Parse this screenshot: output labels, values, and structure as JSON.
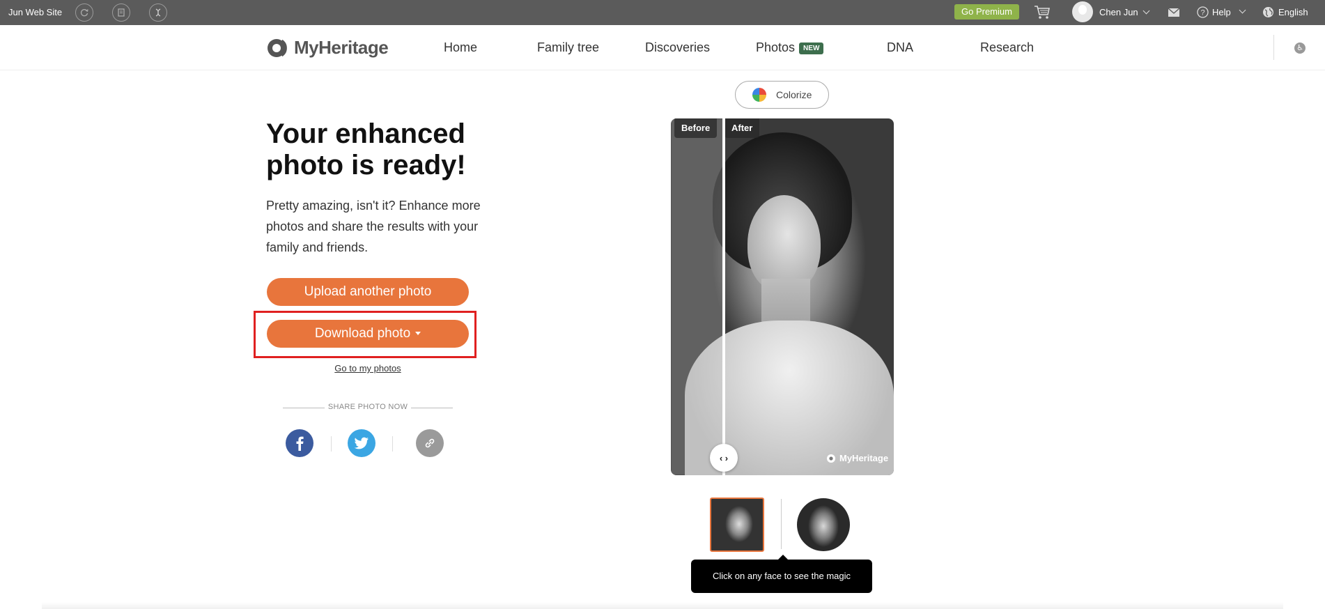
{
  "topbar": {
    "site_name": "Jun Web Site",
    "premium_label": "Go Premium",
    "user_name": "Chen Jun",
    "help_label": "Help",
    "language": "English",
    "premium_color": "#8fb34a"
  },
  "nav": {
    "logo_text": "MyHeritage",
    "items": [
      {
        "label": "Home"
      },
      {
        "label": "Family tree"
      },
      {
        "label": "Discoveries"
      },
      {
        "label": "Photos",
        "badge": "NEW"
      },
      {
        "label": "DNA"
      },
      {
        "label": "Research"
      }
    ]
  },
  "main": {
    "headline": "Your enhanced photo is ready!",
    "subtitle": "Pretty amazing, isn't it? Enhance more photos and share the results with your family and friends.",
    "upload_label": "Upload another photo",
    "download_label": "Download photo",
    "goto_label": "Go to my photos",
    "share_label": "SHARE PHOTO NOW",
    "accent_color": "#e8753c"
  },
  "viewer": {
    "colorize_label": "Colorize",
    "before_label": "Before",
    "after_label": "After",
    "watermark": "MyHeritage",
    "handle_symbol": "‹ ›",
    "tooltip": "Click on any face to see the magic"
  }
}
